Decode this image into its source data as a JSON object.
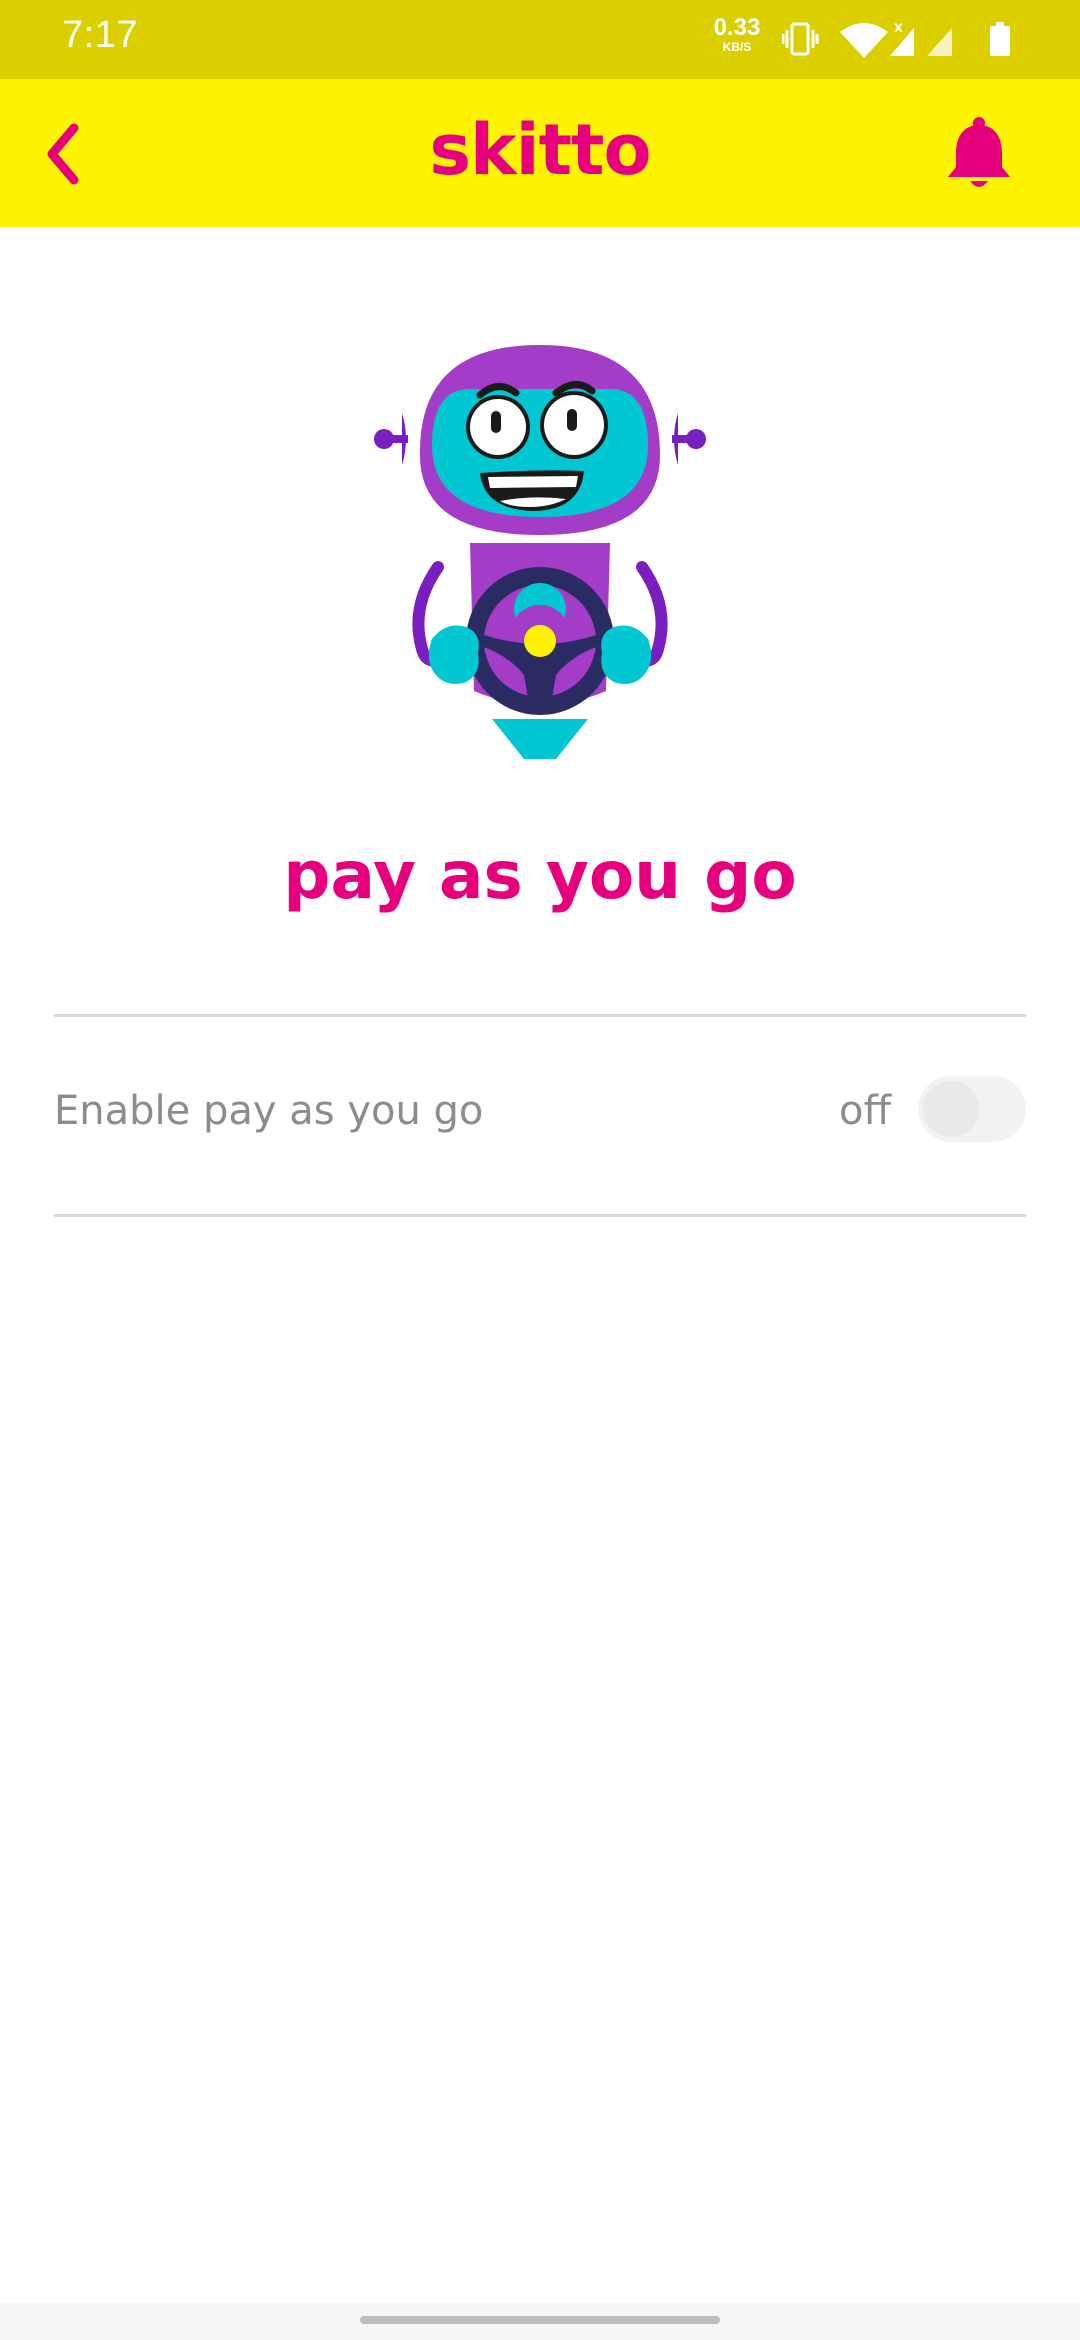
{
  "status_bar": {
    "time": "7:17",
    "net_speed_value": "0.33",
    "net_speed_unit": "KB/S",
    "icons": [
      "vibrate-icon",
      "wifi-icon",
      "signal-icon",
      "signal-icon",
      "battery-icon"
    ]
  },
  "app_bar": {
    "title": "skitto",
    "back_icon": "chevron-left-icon",
    "notification_icon": "bell-icon"
  },
  "main": {
    "illustration": "robot-mascot",
    "title": "pay as you go",
    "setting": {
      "label": "Enable pay as you go",
      "state_text": "off",
      "enabled": false
    }
  },
  "colors": {
    "brand_pink": "#e6007e",
    "app_bar_yellow": "#fff400",
    "status_bar_yellow": "#dbcf00",
    "muted_text": "#8c8c8c"
  }
}
